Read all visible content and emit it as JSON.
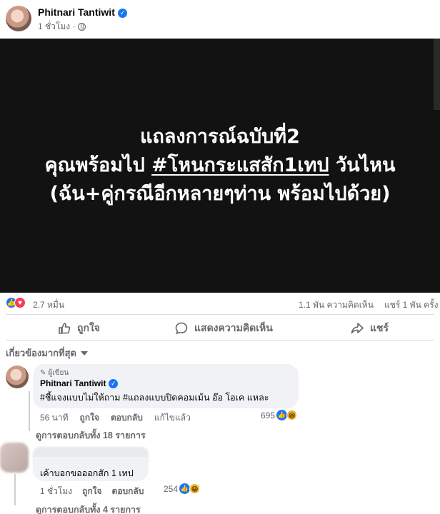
{
  "post": {
    "author": "Phitnari Tantiwit",
    "time": "1 ชั่วโมง ·",
    "image_text": {
      "line1": "แถลงการณ์ฉบับที่2",
      "line2_prefix": "คุณพร้อมไป ",
      "line2_hashtag": "#โหนกระแสสัก1เทป",
      "line2_suffix": " วันไหน",
      "line3": "(ฉัน+คู่กรณีอีกหลายๆท่าน พร้อมไปด้วย)"
    }
  },
  "stats": {
    "reactions": "2.7 หมื่น",
    "comments": "1.1 พัน ความคิดเห็น",
    "shares": "แชร์ 1 พัน ครั้ง"
  },
  "actions": {
    "like": "ถูกใจ",
    "comment": "แสดงความคิดเห็น",
    "share": "แชร์"
  },
  "filter": {
    "label": "เกี่ยวข้องมากที่สุด"
  },
  "comments": [
    {
      "badge": "ผู้เขียน",
      "name": "Phitnari Tantiwit",
      "text": "#ชี้แจงแบบไม่ให้ถาม #แถลงแบบปิดคอมเม้น อ๊อ โอเค แหละ",
      "time": "56 นาที",
      "like": "ถูกใจ",
      "reply": "ตอบกลับ",
      "edited": "แก้ไขแล้ว",
      "reaction_count": "695",
      "replies": "ดูการตอบกลับทั้ง 18 รายการ"
    },
    {
      "text": "เค้าบอกขอออกสัก 1 เทป",
      "time": "1 ชั่วโมง",
      "like": "ถูกใจ",
      "reply": "ตอบกลับ",
      "reaction_count": "254",
      "replies": "ดูการตอบกลับทั้ง 4 รายการ"
    }
  ]
}
